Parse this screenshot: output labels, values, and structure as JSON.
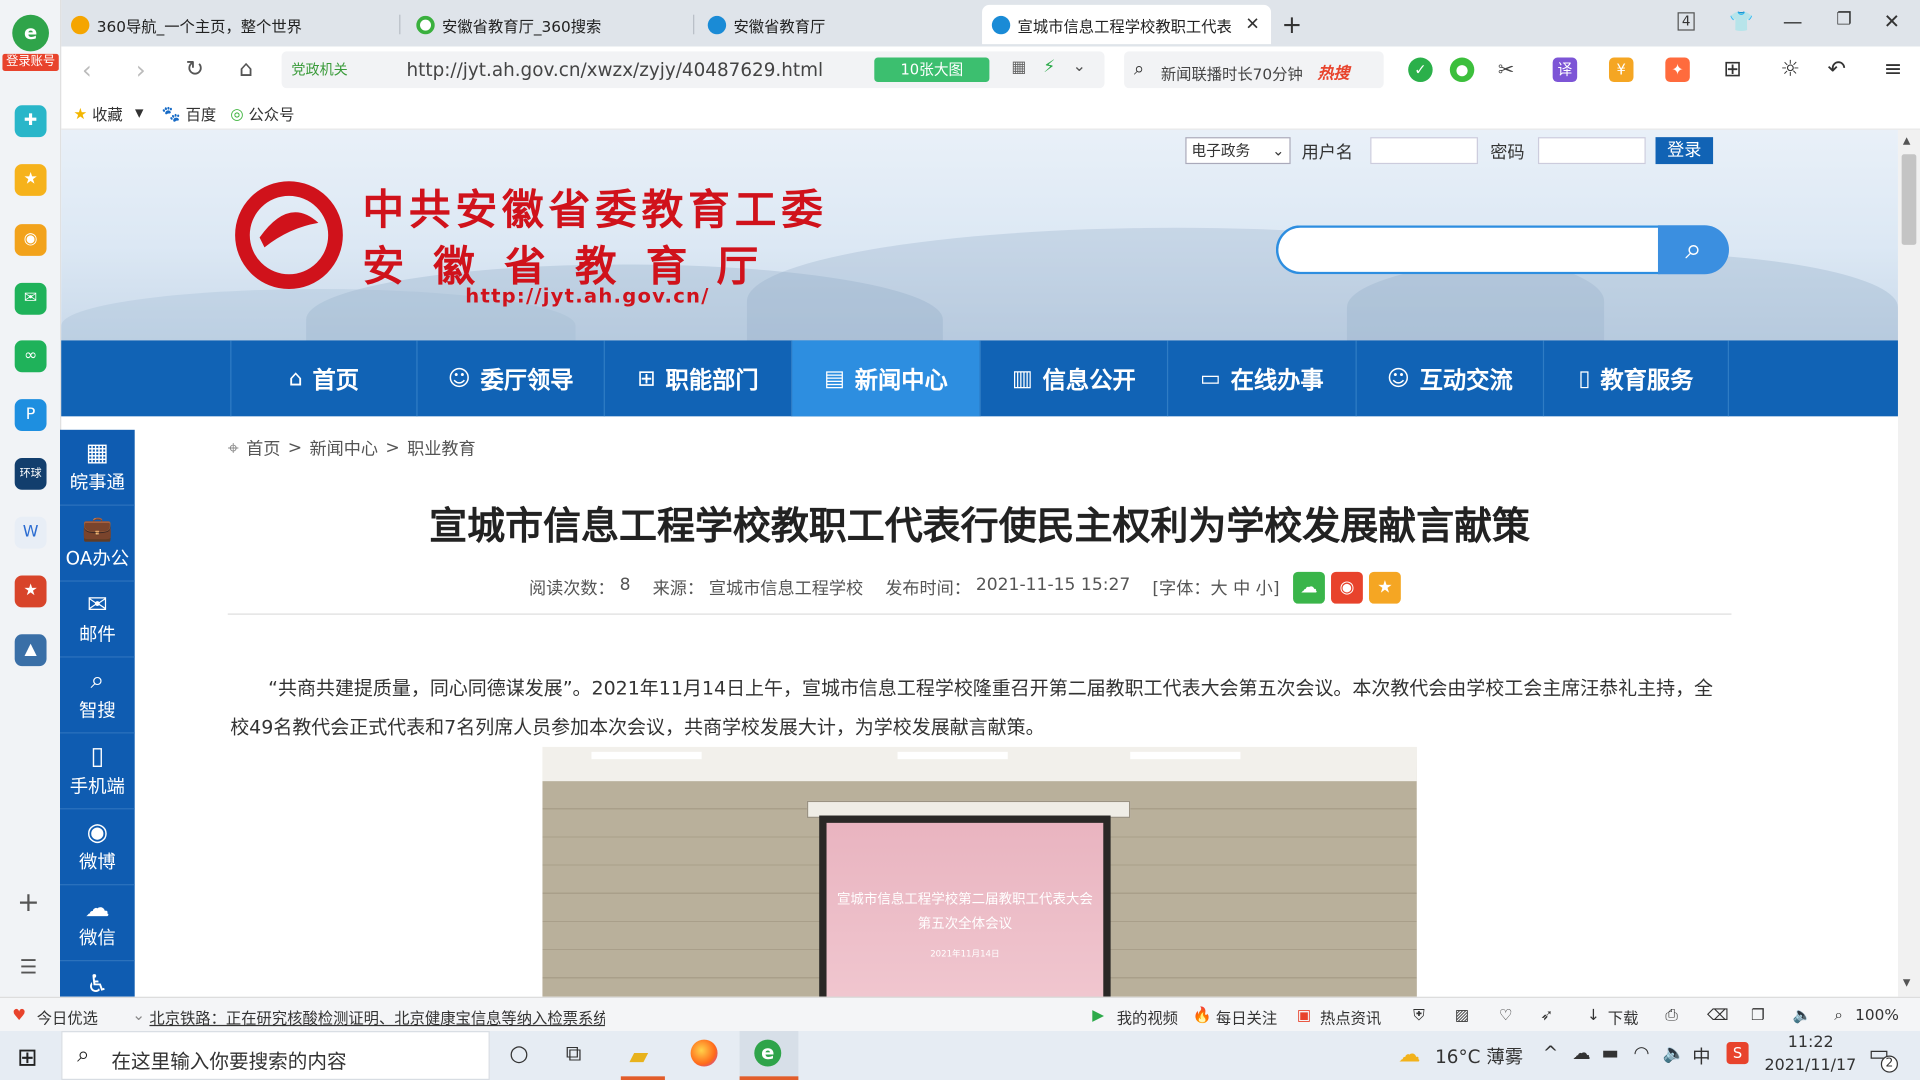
{
  "browser": {
    "tabs": [
      {
        "label": "360导航_一个主页，整个世界"
      },
      {
        "label": "安徽省教育厅_360搜索"
      },
      {
        "label": "安徽省教育厅"
      },
      {
        "label": "宣城市信息工程学校教职工代表"
      }
    ],
    "tab_count": "4",
    "url_prefix": "党政机关",
    "url": "http://jyt.ah.gov.cn/xwzx/zyjy/40487629.html",
    "big_image_label": "10张大图",
    "search_text": "新闻联播时长70分钟",
    "hot_label": "热搜",
    "bookmarks": [
      "收藏",
      "百度",
      "公众号"
    ],
    "login_badge": "登录账号"
  },
  "header": {
    "login_select": "电子政务",
    "username_label": "用户名",
    "password_label": "密码",
    "login_button": "登录",
    "logo_line1": "中共安徽省委教育工委",
    "logo_line2": "安 徽 省 教 育 厅",
    "logo_url": "http://jyt.ah.gov.cn/"
  },
  "nav": [
    {
      "label": "首页",
      "icon": "home-icon"
    },
    {
      "label": "委厅领导",
      "icon": "people-icon"
    },
    {
      "label": "职能部门",
      "icon": "org-icon"
    },
    {
      "label": "新闻中心",
      "icon": "news-icon"
    },
    {
      "label": "信息公开",
      "icon": "document-icon"
    },
    {
      "label": "在线办事",
      "icon": "computer-icon"
    },
    {
      "label": "互动交流",
      "icon": "chat-icon"
    },
    {
      "label": "教育服务",
      "icon": "book-icon"
    }
  ],
  "side_widget": [
    {
      "label": "皖事通",
      "icon": "qrcode-icon"
    },
    {
      "label": "OA办公",
      "icon": "briefcase-icon"
    },
    {
      "label": "邮件",
      "icon": "mail-icon"
    },
    {
      "label": "智搜",
      "icon": "search-icon"
    },
    {
      "label": "手机端",
      "icon": "phone-icon"
    },
    {
      "label": "微博",
      "icon": "weibo-icon"
    },
    {
      "label": "微信",
      "icon": "wechat-icon"
    }
  ],
  "breadcrumb": {
    "home": "首页",
    "sep": ">",
    "l2": "新闻中心",
    "l3": "职业教育"
  },
  "article": {
    "title": "宣城市信息工程学校教职工代表行使民主权利为学校发展献言献策",
    "meta": {
      "views_label": "阅读次数：",
      "views": "8",
      "source_label": "来源：",
      "source": "宣城市信息工程学校",
      "time_label": "发布时间：",
      "time": "2021-11-15 15:27",
      "font_label": "[字体：大 中 小]"
    },
    "paragraph": "“共商共建提质量，同心同德谋发展”。2021年11月14日上午，宣城市信息工程学校隆重召开第二届教职工代表大会第五次会议。本次教代会由学校工会主席汪恭礼主持，全校49名教代会正式代表和7名列席人员参加本次会议，共商学校发展大计，为学校发展献言献策。",
    "photo_screen_line1": "宣城市信息工程学校第二届教职工代表大会",
    "photo_screen_line2": "第五次全体会议",
    "photo_screen_date": "2021年11月14日"
  },
  "statusbar": {
    "left1": "今日优选",
    "news": "北京铁路：正在研究核酸检测证明、北京健康宝信息等纳入检票系统",
    "my_video": "我的视频",
    "daily": "每日关注",
    "hot_news": "热点资讯",
    "download": "下载",
    "zoom": "100%"
  },
  "taskbar": {
    "search_placeholder": "在这里输入你要搜索的内容",
    "weather": "16°C 薄雾",
    "ime": "中",
    "time": "11:22",
    "date": "2021/11/17",
    "notif_count": "2"
  },
  "colors": {
    "nav_blue": "#1163b5",
    "nav_active": "#2d8ee0",
    "logo_red": "#d0121b",
    "widget_blue": "#0f5cb1"
  }
}
